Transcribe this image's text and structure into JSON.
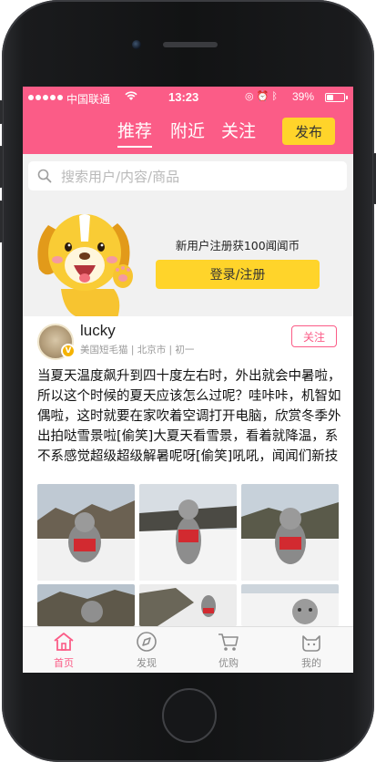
{
  "status_bar": {
    "carrier": "中国联通",
    "time": "13:23",
    "battery": "39%",
    "battery_level": 0.39
  },
  "header": {
    "tabs": [
      {
        "label": "推荐",
        "active": true
      },
      {
        "label": "附近",
        "active": false
      },
      {
        "label": "关注",
        "active": false
      }
    ],
    "publish_label": "发布"
  },
  "search": {
    "placeholder": "搜索用户/内容/商品"
  },
  "promo": {
    "text": "新用户注册获100闻闻币",
    "login_label": "登录/注册"
  },
  "post": {
    "username": "lucky",
    "meta": "美国短毛猫 | 北京市 | 初一",
    "follow_label": "关注",
    "content": "当夏天温度飙升到四十度左右时，外出就会中暑啦，所以这个时候的夏天应该怎么过呢？哇咔咔，机智如偶啦，这时就要在家吹着空调打开电脑，欣赏冬季外出拍哒雪景啦[偷笑]大夏天看雪景，看着就降温，系不系感觉超级超级解暑呢呀[偷笑]吼吼，闻闻们新技能get√啦吧，哇"
  },
  "tab_bar": {
    "items": [
      {
        "label": "首页",
        "icon": "home-icon",
        "active": true
      },
      {
        "label": "发现",
        "icon": "compass-icon",
        "active": false
      },
      {
        "label": "优购",
        "icon": "cart-icon",
        "active": false
      },
      {
        "label": "我的",
        "icon": "cat-profile-icon",
        "active": false
      }
    ]
  },
  "colors": {
    "brand": "#fb5c87",
    "accent": "#ffd42a"
  }
}
